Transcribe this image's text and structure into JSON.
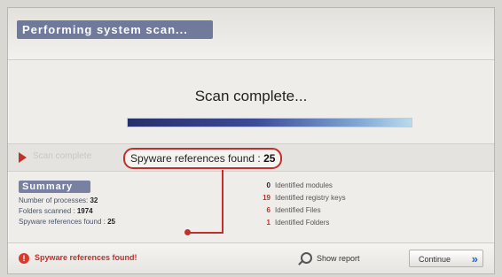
{
  "header": {
    "title": "Performing system scan..."
  },
  "scan": {
    "status_title": "Scan complete...",
    "progress_percent": 100
  },
  "result_row": {
    "faded_label": "Scan complete",
    "callout_text": "Spyware references found : ",
    "callout_count": "25"
  },
  "summary": {
    "title": "Summary",
    "processes_label": "Number of processes: ",
    "processes_value": "32",
    "folders_label": "Folders scanned : ",
    "folders_value": "1974",
    "refs_label": "Spyware references found : ",
    "refs_value": "25"
  },
  "stats": [
    {
      "count": "0",
      "label": "Identified modules"
    },
    {
      "count": "19",
      "label": "Identified registry keys"
    },
    {
      "count": "6",
      "label": "Identified Files"
    },
    {
      "count": "1",
      "label": "Identified Folders"
    }
  ],
  "footer": {
    "alert_icon": "!",
    "alert_text": "Spyware references found!",
    "report_label": "Show report",
    "continue_label": "Continue",
    "continue_icon": "»"
  },
  "colors": {
    "accent": "#c0312b",
    "title_band": "#5b678f",
    "progress_dark": "#27306b",
    "progress_light": "#b9dbef"
  },
  "icons": [
    "arrow-right-icon",
    "alert-icon",
    "search-icon",
    "chevrons-right-icon"
  ]
}
